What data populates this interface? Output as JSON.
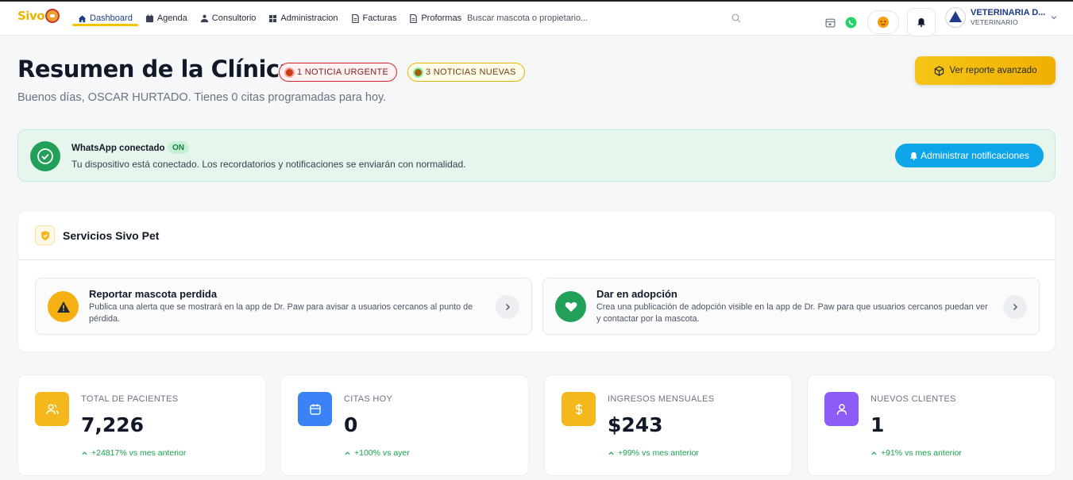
{
  "brand": {
    "name": "Sivo"
  },
  "nav": {
    "items": [
      {
        "label": "Dashboard"
      },
      {
        "label": "Agenda"
      },
      {
        "label": "Consultorio"
      },
      {
        "label": "Administracion"
      },
      {
        "label": "Facturas"
      },
      {
        "label": "Proformas"
      }
    ],
    "active": "Dashboard"
  },
  "search": {
    "placeholder": "Buscar mascota o propietario..."
  },
  "user": {
    "name": "VETERINARIA D...",
    "role": "VETERINARIO"
  },
  "header": {
    "title": "Resumen de la Clínica",
    "urgent_badge": "1 NOTICIA URGENTE",
    "new_badge": "3 NOTICIAS NUEVAS",
    "subtitle": "Buenos días, OSCAR HURTADO. Tienes 0 citas programadas para hoy.",
    "report_button": "Ver reporte avanzado"
  },
  "whatsapp": {
    "title": "WhatsApp conectado",
    "status": "ON",
    "message": "Tu dispositivo está conectado. Los recordatorios y notificaciones se enviarán con normalidad.",
    "manage_button": "Administrar notificaciones"
  },
  "services": {
    "title": "Servicios Sivo Pet",
    "cards": [
      {
        "title": "Reportar mascota perdida",
        "description": "Publica una alerta que se mostrará en la app de Dr. Paw para avisar a usuarios cercanos al punto de pérdida.",
        "icon": "warning-icon",
        "color": "#f5b014"
      },
      {
        "title": "Dar en adopción",
        "description": "Crea una publicación de adopción visible en la app de Dr. Paw para que usuarios cercanos puedan ver y contactar por la mascota.",
        "icon": "heart-icon",
        "color": "#22a05a"
      }
    ]
  },
  "stats": [
    {
      "label": "TOTAL DE PACIENTES",
      "value": "7,226",
      "change": "+24817% vs mes anterior",
      "icon": "users-icon",
      "color": "#f5b81c"
    },
    {
      "label": "CITAS HOY",
      "value": "0",
      "change": "+100% vs ayer",
      "icon": "calendar-icon",
      "color": "#3b82f6"
    },
    {
      "label": "INGRESOS MENSUALES",
      "value": "$243",
      "change": "+99% vs mes anterior",
      "icon": "dollar-icon",
      "color": "#f5b81c"
    },
    {
      "label": "NUEVOS CLIENTES",
      "value": "1",
      "change": "+91% vs mes anterior",
      "icon": "user-icon",
      "color": "#8b5cf6"
    }
  ],
  "colors": {
    "accent": "#f5c400",
    "nav_active": "#1f3a8a",
    "success": "#16a34a",
    "whatsapp_bg": "#e6f6ec",
    "info_button": "#0ea5e9"
  }
}
